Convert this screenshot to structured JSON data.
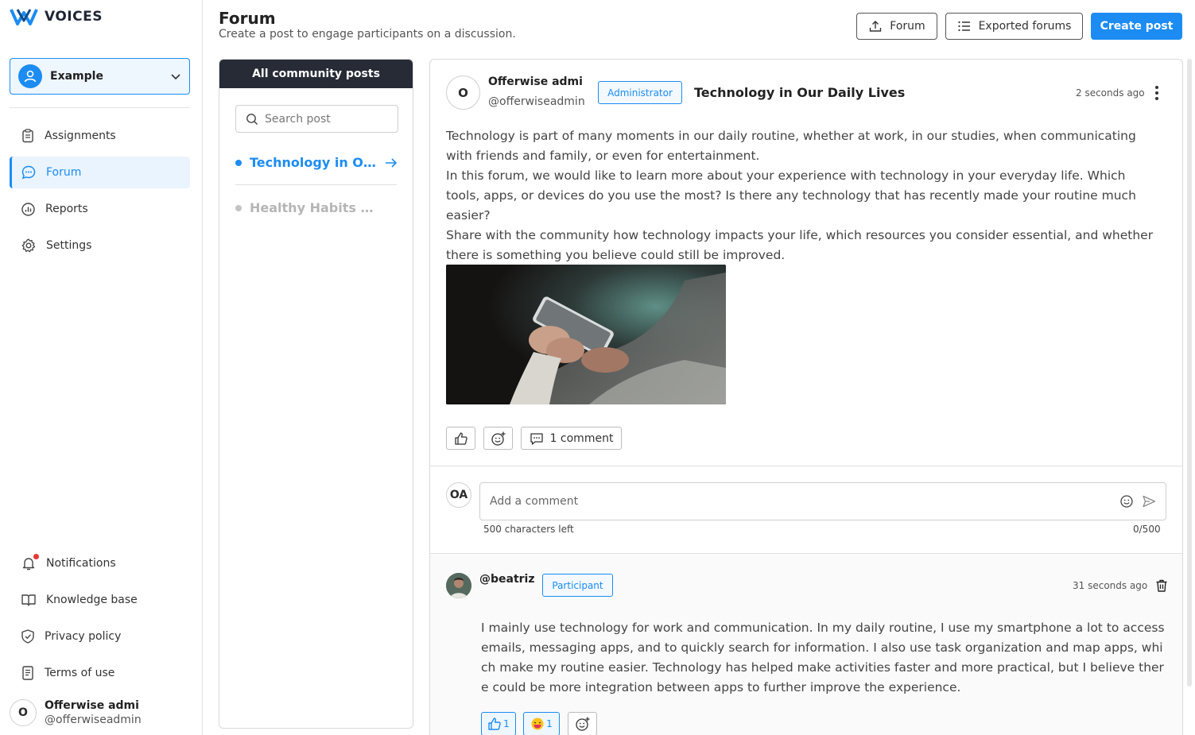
{
  "app": {
    "brand": "VOICES",
    "accent": "#1c8cf2"
  },
  "sidebar": {
    "project": "Example",
    "nav": [
      {
        "label": "Assignments",
        "icon": "clipboard-icon"
      },
      {
        "label": "Forum",
        "icon": "chat-icon",
        "active": true
      },
      {
        "label": "Reports",
        "icon": "chart-icon"
      },
      {
        "label": "Settings",
        "icon": "gear-icon"
      }
    ],
    "bottom": [
      {
        "label": "Notifications",
        "icon": "bell-icon"
      },
      {
        "label": "Knowledge base",
        "icon": "book-icon"
      },
      {
        "label": "Privacy policy",
        "icon": "shield-icon"
      },
      {
        "label": "Terms of use",
        "icon": "document-icon"
      }
    ],
    "user": {
      "initial": "O",
      "name": "Offerwise admi",
      "handle": "@offerwiseadmin"
    }
  },
  "header": {
    "title": "Forum",
    "subtitle": "Create a post to engage participants on a discussion.",
    "buttons": {
      "forum": "Forum",
      "exported": "Exported forums",
      "create": "Create post"
    }
  },
  "posts_list": {
    "header": "All community posts",
    "search_placeholder": "Search post",
    "items": [
      {
        "title": "Technology in Our Daily Lives",
        "active": true
      },
      {
        "title": "Healthy Habits and Wellbeing",
        "active": false
      }
    ]
  },
  "post": {
    "author_initial": "O",
    "author_name": "Offerwise admi",
    "author_handle": "@offerwiseadmin",
    "role": "Administrator",
    "title": "Technology in Our Daily Lives",
    "time": "2 seconds ago",
    "body": [
      "Technology is part of many moments in our daily routine, whether at work, in our studies, when communicating with friends and family, or even for entertainment.",
      "In this forum, we would like to learn more about your experience with technology in your everyday life. Which tools, apps, or devices do you use the most? Is there any technology that has recently made your routine much easier?",
      "Share with the community how technology impacts your life, which resources you consider essential, and whether there is something you believe could still be improved."
    ],
    "comments_label": "1 comment"
  },
  "composer": {
    "initials": "OA",
    "placeholder": "Add a comment",
    "chars_left": "500 characters left",
    "count": "0/500"
  },
  "comment": {
    "handle": "@beatriz",
    "role": "Participant",
    "time": "31 seconds ago",
    "text": "I mainly use technology for work and communication. In my daily routine, I use my smartphone a lot to access emails, messaging apps, and to quickly search for information. I also use task organization and map apps, which make my routine easier. Technology has helped make activities faster and more practical, but I believe there could be more integration between apps to further improve the experience.",
    "reactions": [
      {
        "icon": "thumbs-up-icon",
        "count": "1"
      },
      {
        "icon": "laugh-emoji-icon",
        "count": "1"
      }
    ]
  }
}
